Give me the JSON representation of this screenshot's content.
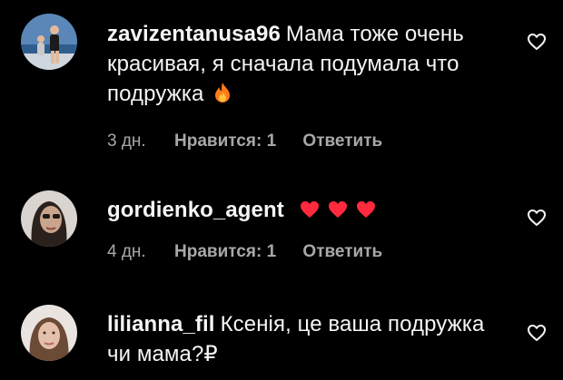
{
  "comments": [
    {
      "username": "zavizentanusa96",
      "text": "Мама тоже очень красивая, я сначала подумала что подружка",
      "emoji_icon": "fire-icon",
      "age": "3 дн.",
      "likes": "Нравится: 1",
      "reply": "Ответить"
    },
    {
      "username": "gordienko_agent",
      "text": "",
      "emoji_icon": "red-heart-icon",
      "age": "4 дн.",
      "likes": "Нравится: 1",
      "reply": "Ответить"
    },
    {
      "username": "lilianna_fil",
      "text": "Ксенія, це ваша подружка чи мама?₽"
    }
  ],
  "colors": {
    "background": "#000000",
    "text": "#f5f5f5",
    "meta": "#a8a8a8",
    "heart": "#ff2a3d",
    "fire": "#ff7a1a"
  }
}
